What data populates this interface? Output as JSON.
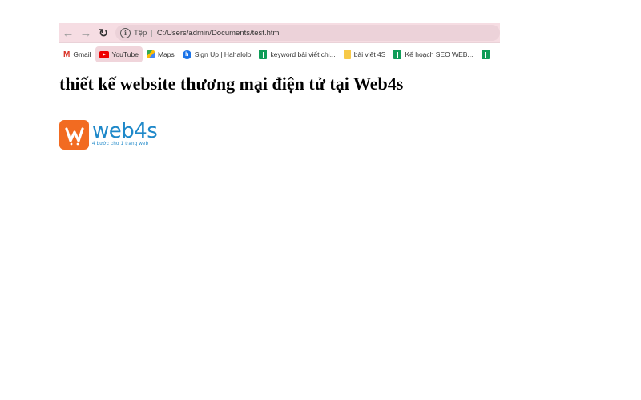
{
  "browser": {
    "address_bar": {
      "scheme_label": "Tệp",
      "separator": "|",
      "url": "C:/Users/admin/Documents/test.html"
    },
    "bookmarks": [
      {
        "label": "Gmail",
        "icon": "gmail-icon"
      },
      {
        "label": "YouTube",
        "icon": "youtube-icon"
      },
      {
        "label": "Maps",
        "icon": "maps-icon"
      },
      {
        "label": "Sign Up | Hahalolo",
        "icon": "hahalolo-icon"
      },
      {
        "label": "keyword bài viết chi...",
        "icon": "sheets-icon"
      },
      {
        "label": "bài viết 4S",
        "icon": "note-icon"
      },
      {
        "label": "Kế hoạch SEO WEB...",
        "icon": "sheets-icon"
      }
    ]
  },
  "page": {
    "heading": "thiết kế website thương mại điện tử tại Web4s",
    "logo": {
      "wordmark": "web4s",
      "tagline": "4 bước cho 1 trang web"
    }
  },
  "colors": {
    "toolbar_bg": "#f6dde3",
    "brand_orange": "#f26b21",
    "brand_blue": "#1e88c9"
  }
}
